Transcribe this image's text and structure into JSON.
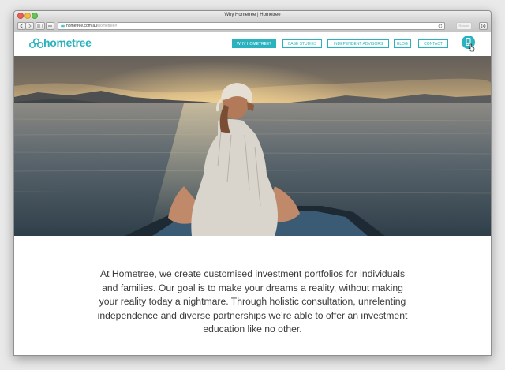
{
  "browser": {
    "window_title": "Why Hometree | Hometree",
    "url_host": "hometree.com.au",
    "url_path": "/hometree#",
    "reader_label": "Reader"
  },
  "site": {
    "logo_text": "hometree",
    "nav": [
      {
        "label": "WHY HOMETREE?",
        "active": true
      },
      {
        "label": "CASE STUDIES",
        "active": false
      },
      {
        "label": "INDEPENDENT ADVISORS",
        "active": false
      },
      {
        "label": "BLOG",
        "active": false
      },
      {
        "label": "CONTACT",
        "active": false
      }
    ],
    "intro_text": "At Hometree, we create customised investment portfolios for individuals and families. Our goal is to make your dreams a reality, without making your reality today a nightmare. Through holistic consultation, unrelenting independence and diverse partnerships we’re able to offer an investment education like no other."
  },
  "colors": {
    "brand": "#2ab3bf"
  },
  "icons": {
    "logo": "three-circles-logo-icon",
    "phone": "phone-icon"
  }
}
